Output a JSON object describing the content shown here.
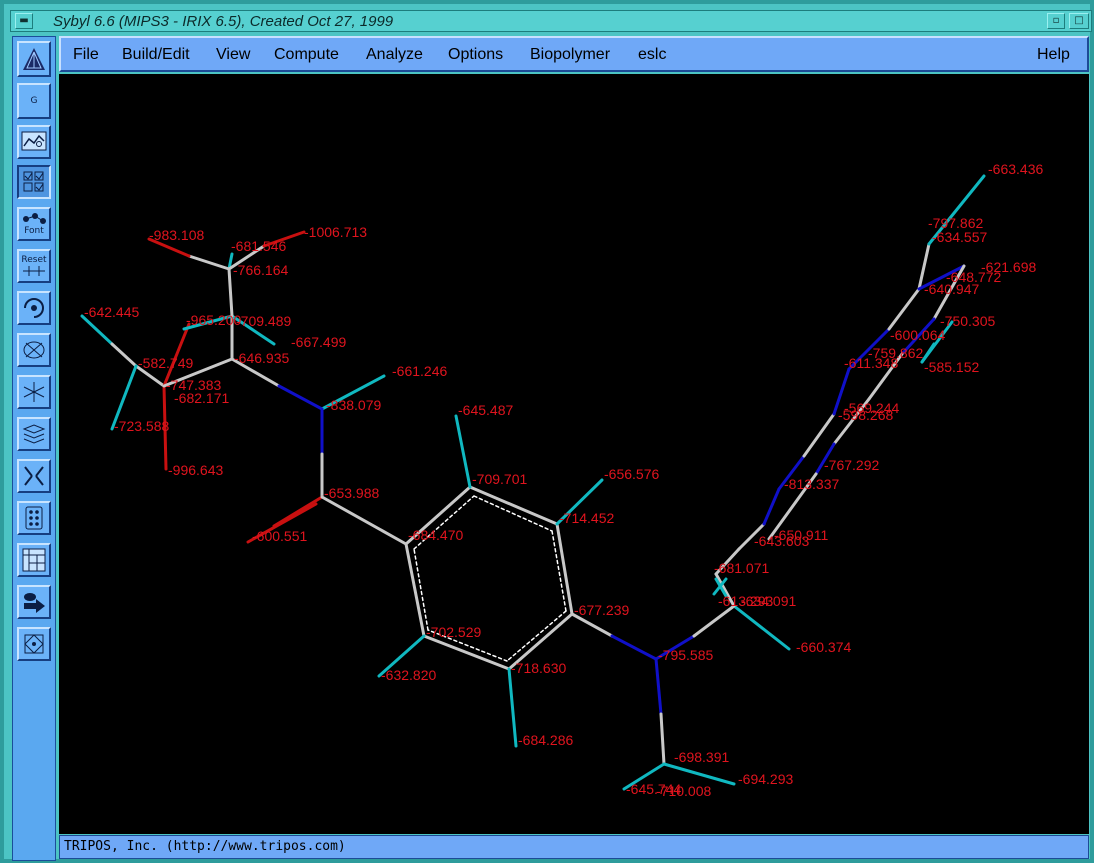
{
  "window": {
    "title": "Sybyl 6.6 (MIPS3 - IRIX 6.5), Created Oct 27, 1999",
    "minimize_icon": "window-menu-icon",
    "iconify_icon": "iconify-icon",
    "maximize_icon": "maximize-icon"
  },
  "menu": {
    "file": "File",
    "build_edit": "Build/Edit",
    "view": "View",
    "compute": "Compute",
    "analyze": "Analyze",
    "options": "Options",
    "biopolymer": "Biopolymer",
    "eslc": "eslc",
    "help": "Help"
  },
  "tools": {
    "g_label": "G",
    "font_label": "Font",
    "reset_label": "Reset"
  },
  "status": {
    "text": "TRIPOS, Inc. (http://www.tripos.com)"
  },
  "colors": {
    "carbon_bond": "#c8c8c8",
    "nitrogen_bond": "#1010c8",
    "oxygen_bond": "#c81010",
    "hydrogen_bond": "#10b8c0",
    "label": "#e0141e"
  },
  "atom_labels": [
    "-663.436",
    "-797.862",
    "-634.557",
    "-648.772",
    "-621.698",
    "-640.947",
    "-750.305",
    "-600.064",
    "-759.862",
    "-585.152",
    "-611.348",
    "-569.244",
    "-598.268",
    "-767.292",
    "-813.337",
    "-650.911",
    "-643.603",
    "-681.071",
    "-613.293",
    "-634.091",
    "-660.374",
    "-983.108",
    "-681.546",
    "-1006.713",
    "-766.164",
    "-642.445",
    "-965.200",
    "-709.489",
    "-667.499",
    "-646.935",
    "-582.749",
    "-747.383",
    "-682.171",
    "-661.246",
    "-838.079",
    "-723.588",
    "-996.643",
    "-645.487",
    "-709.701",
    "-656.576",
    "-653.988",
    "-714.452",
    "-684.470",
    "-600.551",
    "-677.239",
    "-702.529",
    "-795.585",
    "-632.820",
    "-718.630",
    "-684.286",
    "-698.391",
    "-694.293",
    "-645.744",
    "-710.008"
  ]
}
